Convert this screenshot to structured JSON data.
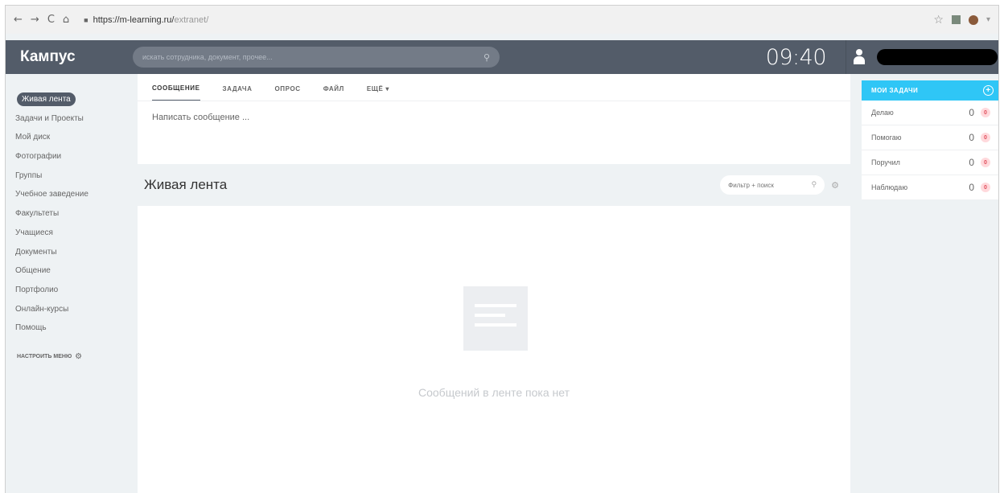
{
  "browser": {
    "back_icon": "←",
    "forward_icon": "→",
    "reload_icon": "C",
    "home_icon": "⌂",
    "url_host": "https://m-learning.ru/",
    "url_path": "extranet/",
    "star_icon": "☆",
    "menu_icon": "▾"
  },
  "header": {
    "logo": "Кампус",
    "search_placeholder": "искать сотрудника, документ, прочее...",
    "search_icon": "⚲",
    "clock": "09:40"
  },
  "sidebar": {
    "items": [
      {
        "label": "Живая лента"
      },
      {
        "label": "Задачи и Проекты"
      },
      {
        "label": "Мой диск"
      },
      {
        "label": "Фотографии"
      },
      {
        "label": "Группы"
      },
      {
        "label": "Учебное заведение"
      },
      {
        "label": "Факультеты"
      },
      {
        "label": "Учащиеся"
      },
      {
        "label": "Документы"
      },
      {
        "label": "Общение"
      },
      {
        "label": "Портфолио"
      },
      {
        "label": "Онлайн-курсы"
      },
      {
        "label": "Помощь"
      }
    ],
    "configure_label": "НАСТРОИТЬ МЕНЮ",
    "configure_icon": "⚙"
  },
  "composer": {
    "tabs": [
      {
        "label": "СООБЩЕНИЕ"
      },
      {
        "label": "ЗАДАЧА"
      },
      {
        "label": "ОПРОС"
      },
      {
        "label": "ФАЙЛ"
      },
      {
        "label": "ЕЩЁ ▾"
      }
    ],
    "placeholder": "Написать сообщение ..."
  },
  "feed": {
    "title": "Живая лента",
    "filter_placeholder": "Фильтр + поиск",
    "filter_icon": "⚲",
    "settings_icon": "⚙",
    "empty_text": "Сообщений в ленте пока нет"
  },
  "tasks": {
    "title": "МОИ ЗАДАЧИ",
    "add_icon": "+",
    "rows": [
      {
        "label": "Делаю",
        "count": "0",
        "badge": "0"
      },
      {
        "label": "Помогаю",
        "count": "0",
        "badge": "0"
      },
      {
        "label": "Поручил",
        "count": "0",
        "badge": "0"
      },
      {
        "label": "Наблюдаю",
        "count": "0",
        "badge": "0"
      }
    ]
  },
  "colors": {
    "header_bg": "#535c69",
    "tasks_accent": "#2fc6f6",
    "page_bg": "#eef2f4"
  }
}
